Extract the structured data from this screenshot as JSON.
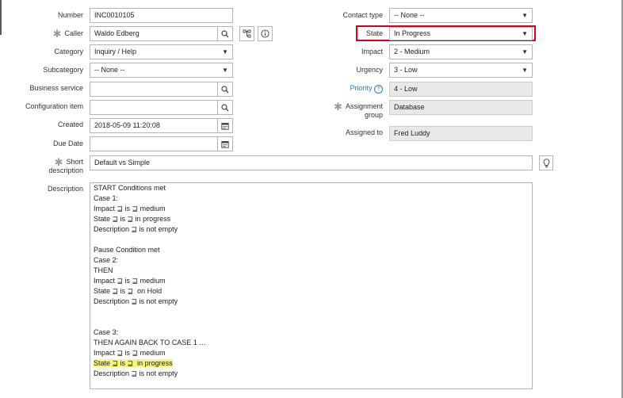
{
  "form": {
    "number": {
      "label": "Number",
      "value": "INC0010105"
    },
    "caller": {
      "label": "Caller",
      "value": "Waldo Edberg"
    },
    "category": {
      "label": "Category",
      "value": "Inquiry / Help"
    },
    "subcategory": {
      "label": "Subcategory",
      "value": "-- None --"
    },
    "business_service": {
      "label": "Business service",
      "value": ""
    },
    "configuration_item": {
      "label": "Configuration item",
      "value": ""
    },
    "created": {
      "label": "Created",
      "value": "2018-05-09 11:20:08"
    },
    "due_date": {
      "label": "Due Date",
      "value": ""
    },
    "short_description": {
      "label_line1": "Short",
      "label_line2": "description",
      "value": "Default vs Simple"
    },
    "contact_type": {
      "label": "Contact type",
      "value": "-- None --"
    },
    "state": {
      "label": "State",
      "value": "In Progress"
    },
    "impact": {
      "label": "Impact",
      "value": "2 - Medium"
    },
    "urgency": {
      "label": "Urgency",
      "value": "3 - Low"
    },
    "priority": {
      "label": "Priority",
      "value": "4 - Low"
    },
    "assignment_group": {
      "label_line1": "Assignment",
      "label_line2": "group",
      "value": "Database"
    },
    "assigned_to": {
      "label": "Assigned to",
      "value": "Fred Luddy"
    },
    "description": {
      "label": "Description",
      "lines": [
        "START Conditions met",
        "Case 1:",
        "Impact ⊒ is ⊒ medium",
        "State ⊒ is ⊒ in progress",
        "Description ⊒ is not empty",
        "",
        "Pause Condition met",
        "Case 2:",
        "THEN",
        "Impact ⊒ is ⊒ medium",
        "State ⊒ is ⊒  on Hold",
        "Description ⊒ is not empty",
        "",
        "",
        "Case 3:",
        "THEN AGAIN BACK TO CASE 1 …",
        "Impact ⊒ is ⊒ medium",
        "State ⊒ is ⊒  in progress",
        "Description ⊒ is not empty"
      ]
    }
  },
  "icons": {
    "search": "search-icon",
    "calendar": "calendar-icon",
    "dropdown": "▼",
    "tree": "tree-icon",
    "info": "info-icon",
    "help": "?",
    "lightbulb": "lightbulb-icon",
    "required": "✱"
  },
  "colors": {
    "highlight": "#f6f57a",
    "state_outline": "#d6001c",
    "priority_link": "#2b7bd1",
    "readonly_bg": "#e8e8e8"
  }
}
